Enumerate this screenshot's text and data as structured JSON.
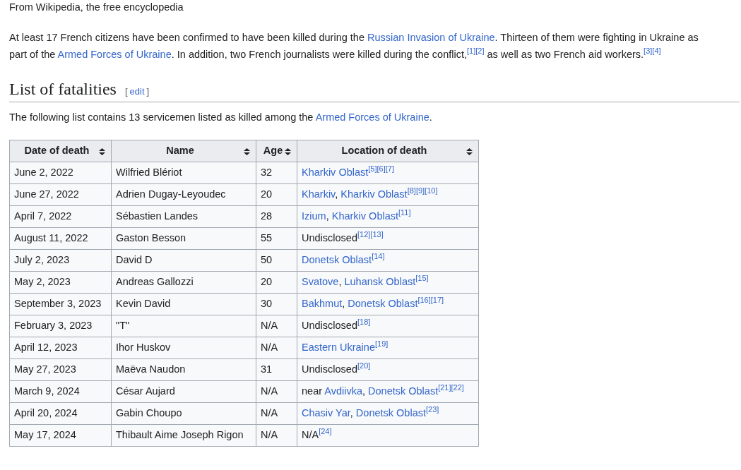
{
  "tagline": "From Wikipedia, the free encyclopedia",
  "intro": [
    {
      "kind": "text",
      "text": "At least 17 French citizens have been confirmed to have been killed during the "
    },
    {
      "kind": "link",
      "text": "Russian Invasion of Ukraine"
    },
    {
      "kind": "text",
      "text": ". Thirteen of them were fighting in Ukraine as part of the "
    },
    {
      "kind": "link",
      "text": "Armed Forces of Ukraine"
    },
    {
      "kind": "text",
      "text": ". In addition, two French journalists were killed during the conflict,"
    },
    {
      "kind": "ref",
      "text": "[1]"
    },
    {
      "kind": "ref",
      "text": "[2]"
    },
    {
      "kind": "text",
      "text": " as well as two French aid workers."
    },
    {
      "kind": "ref",
      "text": "[3]"
    },
    {
      "kind": "ref",
      "text": "[4]"
    }
  ],
  "section": {
    "heading": "List of fatalities",
    "edit_open": "[",
    "edit_link": "edit",
    "edit_close": "]"
  },
  "lead": [
    {
      "kind": "text",
      "text": "The following list contains 13 servicemen listed as killed among the "
    },
    {
      "kind": "link",
      "text": "Armed Forces of Ukraine"
    },
    {
      "kind": "text",
      "text": "."
    }
  ],
  "table": {
    "columns": [
      "Date of death",
      "Name",
      "Age",
      "Location of death"
    ],
    "rows": [
      {
        "date": "June 2, 2022",
        "name": "Wilfried Blériot",
        "age": "32",
        "location": [
          {
            "kind": "link",
            "text": "Kharkiv Oblast"
          },
          {
            "kind": "ref",
            "text": "[5]"
          },
          {
            "kind": "ref",
            "text": "[6]"
          },
          {
            "kind": "ref",
            "text": "[7]"
          }
        ]
      },
      {
        "date": "June 27, 2022",
        "name": "Adrien Dugay-Leyoudec",
        "age": "20",
        "location": [
          {
            "kind": "link",
            "text": "Kharkiv"
          },
          {
            "kind": "text",
            "text": ", "
          },
          {
            "kind": "link",
            "text": "Kharkiv Oblast"
          },
          {
            "kind": "ref",
            "text": "[8]"
          },
          {
            "kind": "ref",
            "text": "[9]"
          },
          {
            "kind": "ref",
            "text": "[10]"
          }
        ]
      },
      {
        "date": "April 7, 2022",
        "name": "Sébastien Landes",
        "age": "28",
        "location": [
          {
            "kind": "link",
            "text": "Izium"
          },
          {
            "kind": "text",
            "text": ", "
          },
          {
            "kind": "link",
            "text": "Kharkiv Oblast"
          },
          {
            "kind": "ref",
            "text": "[11]"
          }
        ]
      },
      {
        "date": "August 11, 2022",
        "name": "Gaston Besson",
        "age": "55",
        "location": [
          {
            "kind": "text",
            "text": "Undisclosed"
          },
          {
            "kind": "ref",
            "text": "[12]"
          },
          {
            "kind": "ref",
            "text": "[13]"
          }
        ]
      },
      {
        "date": "July 2, 2023",
        "name": "David D",
        "age": "50",
        "location": [
          {
            "kind": "link",
            "text": "Donetsk Oblast"
          },
          {
            "kind": "ref",
            "text": "[14]"
          }
        ]
      },
      {
        "date": "May 2, 2023",
        "name": "Andreas Gallozzi",
        "age": "20",
        "location": [
          {
            "kind": "link",
            "text": "Svatove"
          },
          {
            "kind": "text",
            "text": ", "
          },
          {
            "kind": "link",
            "text": "Luhansk Oblast"
          },
          {
            "kind": "ref",
            "text": "[15]"
          }
        ]
      },
      {
        "date": "September 3, 2023",
        "name": "Kevin David",
        "age": "30",
        "location": [
          {
            "kind": "link",
            "text": "Bakhmut"
          },
          {
            "kind": "text",
            "text": ", "
          },
          {
            "kind": "link",
            "text": "Donetsk Oblast"
          },
          {
            "kind": "ref",
            "text": "[16]"
          },
          {
            "kind": "ref",
            "text": "[17]"
          }
        ]
      },
      {
        "date": "February 3, 2023",
        "name": "\"T\"",
        "age": "N/A",
        "location": [
          {
            "kind": "text",
            "text": "Undisclosed"
          },
          {
            "kind": "ref",
            "text": "[18]"
          }
        ]
      },
      {
        "date": "April 12, 2023",
        "name": "Ihor Huskov",
        "age": "N/A",
        "location": [
          {
            "kind": "link",
            "text": "Eastern Ukraine"
          },
          {
            "kind": "ref",
            "text": "[19]"
          }
        ]
      },
      {
        "date": "May 27, 2023",
        "name": "Maëva Naudon",
        "age": "31",
        "location": [
          {
            "kind": "text",
            "text": "Undisclosed"
          },
          {
            "kind": "ref",
            "text": "[20]"
          }
        ]
      },
      {
        "date": "March 9, 2024",
        "name": "César Aujard",
        "age": "N/A",
        "location": [
          {
            "kind": "text",
            "text": "near "
          },
          {
            "kind": "link",
            "text": "Avdiivka"
          },
          {
            "kind": "text",
            "text": ", "
          },
          {
            "kind": "link",
            "text": "Donetsk Oblast"
          },
          {
            "kind": "ref",
            "text": "[21]"
          },
          {
            "kind": "ref",
            "text": "[22]"
          }
        ]
      },
      {
        "date": "April 20, 2024",
        "name": "Gabin Choupo",
        "age": "N/A",
        "location": [
          {
            "kind": "link",
            "text": "Chasiv Yar"
          },
          {
            "kind": "text",
            "text": ", "
          },
          {
            "kind": "link",
            "text": "Donetsk Oblast"
          },
          {
            "kind": "ref",
            "text": "[23]"
          }
        ]
      },
      {
        "date": "May 17, 2024",
        "name": "Thibault Aime Joseph Rigon",
        "age": "N/A",
        "location": [
          {
            "kind": "text",
            "text": "N/A"
          },
          {
            "kind": "ref",
            "text": "[24]"
          }
        ]
      }
    ]
  }
}
